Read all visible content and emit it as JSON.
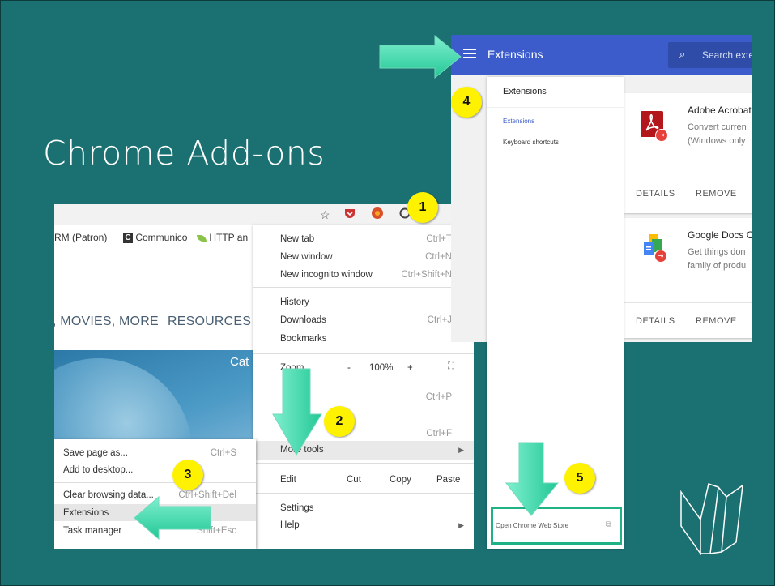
{
  "slide": {
    "title": "Chrome Add-ons",
    "steps": [
      "1",
      "2",
      "3",
      "4",
      "5"
    ],
    "colors": {
      "background": "#1b7072",
      "step_badge": "#fff200",
      "arrow": "#3ee0b0",
      "highlight_border": "#20b184"
    }
  },
  "chrome": {
    "toolbar_icons": [
      "star-icon",
      "pocket-icon",
      "lastpass-icon",
      "extension-icon",
      "kebab-menu-icon"
    ],
    "bookmarks": {
      "item1": "RM (Patron)",
      "item2": "Communico",
      "item3": "HTTP an"
    },
    "nav": {
      "item1": ", MOVIES, MORE",
      "item2": "RESOURCES"
    },
    "hero_text": "Cat",
    "menu": {
      "new_tab": "New tab",
      "new_tab_sc": "Ctrl+T",
      "new_window": "New window",
      "new_window_sc": "Ctrl+N",
      "incognito": "New incognito window",
      "incognito_sc": "Ctrl+Shift+N",
      "history": "History",
      "downloads": "Downloads",
      "downloads_sc": "Ctrl+J",
      "bookmarks": "Bookmarks",
      "zoom_label": "Zoom",
      "zoom_minus": "-",
      "zoom_value": "100%",
      "zoom_plus": "+",
      "print_sc": "Ctrl+P",
      "find_sc": "Ctrl+F",
      "more_tools": "More tools",
      "edit": "Edit",
      "cut": "Cut",
      "copy": "Copy",
      "paste": "Paste",
      "settings": "Settings",
      "help": "Help"
    },
    "submenu": {
      "save_page": "Save page as...",
      "save_page_sc": "Ctrl+S",
      "add_desktop": "Add to desktop...",
      "clear_data": "Clear browsing data...",
      "clear_data_sc": "Ctrl+Shift+Del",
      "extensions": "Extensions",
      "task_manager": "Task manager",
      "task_manager_sc": "Shift+Esc"
    }
  },
  "extensions_page": {
    "header_title": "Extensions",
    "search_placeholder": "Search exte",
    "sidebar": {
      "heading": "Extensions",
      "link_extensions": "Extensions",
      "link_shortcuts": "Keyboard shortcuts",
      "store_link": "Open Chrome Web Store"
    },
    "cards": [
      {
        "name": "Adobe Acrobat",
        "desc1": "Convert curren",
        "desc2": "(Windows only",
        "details": "DETAILS",
        "remove": "REMOVE"
      },
      {
        "name": "Google Docs O",
        "desc1": "Get things don",
        "desc2": "family of produ",
        "details": "DETAILS",
        "remove": "REMOVE"
      }
    ]
  }
}
